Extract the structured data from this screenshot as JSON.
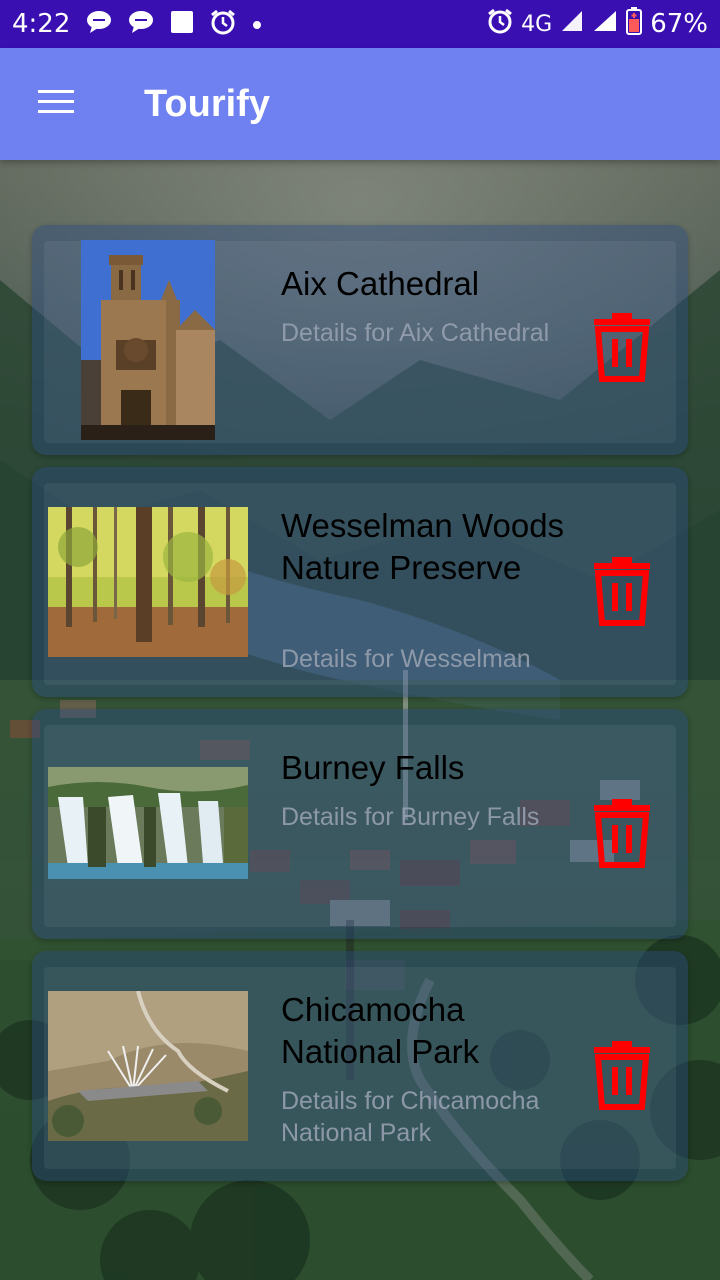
{
  "status_bar": {
    "time": "4:22",
    "network": "4G",
    "battery": "67%",
    "left_icons": [
      "chat-bubble-icon",
      "chat-bubble-icon",
      "square-notification-icon",
      "alarm-icon",
      "dot-icon"
    ],
    "right_icons": [
      "alarm-icon",
      "signal-icon",
      "wifi-signal-icon",
      "battery-icon"
    ]
  },
  "app_bar": {
    "title": "Tourify",
    "menu_icon": "hamburger-menu-icon",
    "color": "#6f80f0"
  },
  "places": [
    {
      "name": "Aix Cathedral",
      "details": "Details for Aix Cathedral",
      "image": "cathedral-photo"
    },
    {
      "name": "Wesselman Woods Nature Preserve",
      "details": "Details for Wesselman",
      "image": "forest-photo"
    },
    {
      "name": "Burney Falls",
      "details": "Details for Burney Falls",
      "image": "waterfall-photo"
    },
    {
      "name": "Chicamocha National Park",
      "details": "Details for Chicamocha National Park",
      "image": "canyon-park-photo"
    }
  ],
  "delete_icon": "trash-icon",
  "colors": {
    "status_bar": "#3a0fb2",
    "delete": "#ff0000"
  }
}
